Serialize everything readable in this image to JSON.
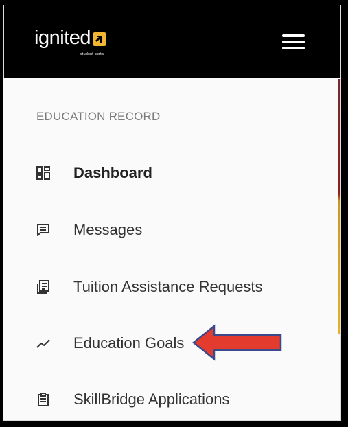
{
  "app": {
    "logo_text": "ignited",
    "logo_subtext": "student portal"
  },
  "sidebar": {
    "section_title": "EDUCATION RECORD",
    "items": [
      {
        "label": "Dashboard",
        "icon": "dashboard-icon",
        "active": true
      },
      {
        "label": "Messages",
        "icon": "message-icon"
      },
      {
        "label": "Tuition Assistance Requests",
        "icon": "document-icon"
      },
      {
        "label": "Education Goals",
        "icon": "trend-line-icon"
      },
      {
        "label": "SkillBridge Applications",
        "icon": "clipboard-icon"
      }
    ]
  },
  "colors": {
    "header_bg": "#000000",
    "panel_bg": "#fafafa",
    "logo_accent": "#f2b632",
    "annotation_arrow_fill": "#e33b2e",
    "annotation_arrow_stroke": "#3a4a8a"
  }
}
